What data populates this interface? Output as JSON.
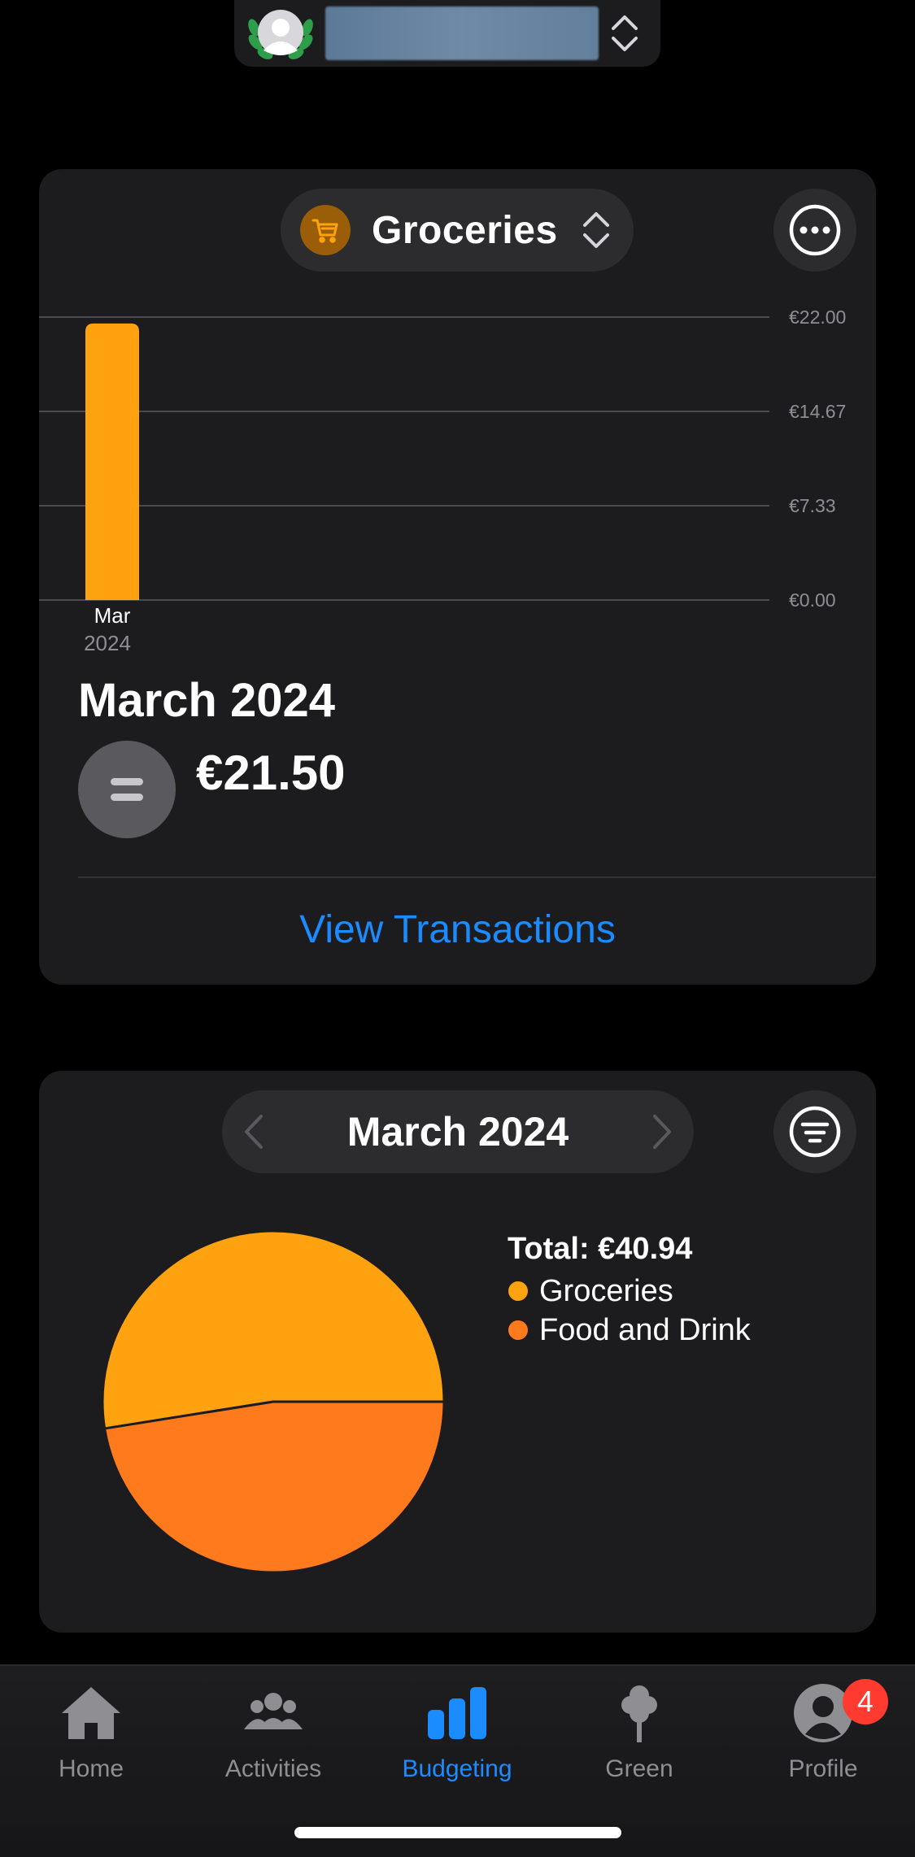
{
  "header": {
    "avatar_icon": "avatar-wreath-icon",
    "switch_icon": "chevron-up-down-icon"
  },
  "budget_card": {
    "category": "Groceries",
    "category_icon": "shopping-cart-icon",
    "category_color": "#FFA20F",
    "more_icon": "ellipsis-circle-icon",
    "period_title": "March 2024",
    "trend_icon": "equal-icon",
    "amount": "€21.50",
    "view_transactions": "View Transactions"
  },
  "chart_data": [
    {
      "type": "bar",
      "categories": [
        "Mar"
      ],
      "category_sublabels": [
        "2024"
      ],
      "values": [
        21.5
      ],
      "y_ticks": [
        "€22.00",
        "€14.67",
        "€7.33",
        "€0.00"
      ],
      "ylim": [
        0,
        22
      ],
      "axis_position": "right",
      "grid": true,
      "colors": [
        "#FFA20F"
      ]
    },
    {
      "type": "pie",
      "total_label": "Total: €40.94",
      "labels": [
        "Groceries",
        "Food and Drink"
      ],
      "values": [
        21.5,
        19.44
      ],
      "colors": [
        "#FFA20F",
        "#FF7A1C"
      ],
      "legend_position": "right"
    }
  ],
  "pie_card": {
    "month": "March 2024",
    "prev_icon": "chevron-left-icon",
    "next_icon": "chevron-right-icon",
    "filter_icon": "filter-lines-icon"
  },
  "tab_bar": {
    "items": [
      {
        "label": "Home",
        "icon": "house-icon"
      },
      {
        "label": "Activities",
        "icon": "people-icon"
      },
      {
        "label": "Budgeting",
        "icon": "bar-chart-icon",
        "active": true
      },
      {
        "label": "Green",
        "icon": "tree-icon"
      },
      {
        "label": "Profile",
        "icon": "person-circle-icon",
        "badge": "4"
      }
    ],
    "active_color": "#1A8CFF",
    "badge_color": "#FF3B30"
  }
}
